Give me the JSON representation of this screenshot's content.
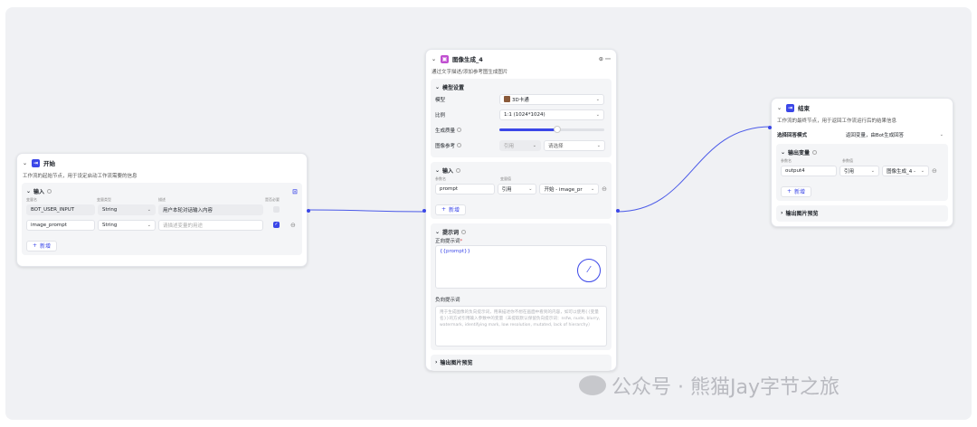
{
  "colors": {
    "accent": "#3b47e8",
    "start_icon": "#3b47e8",
    "image_icon": "#c04fd0",
    "end_icon": "#3b47e8"
  },
  "start_node": {
    "title": "开始",
    "icon": "start-icon",
    "description": "工作流的起始节点，用于设定启动工作流需要的信息",
    "input_section": "输入",
    "col_var": "变量名",
    "col_type": "变量类型",
    "col_desc": "描述",
    "col_required": "是否必要",
    "rows": [
      {
        "name": "BOT_USER_INPUT",
        "type": "String",
        "desc": "用户本轮对话输入内容"
      },
      {
        "name": "image_prompt",
        "type": "String",
        "desc": "请描述变量的用途"
      }
    ],
    "add_label": "新增"
  },
  "image_node": {
    "title": "图像生成_4",
    "icon": "image-icon",
    "description": "通过文字描述/添加参考图生成图片",
    "model_section": "模型设置",
    "model_label": "模型",
    "model_value": "3D卡通",
    "ratio_label": "比例",
    "ratio_value": "1:1 (1024*1024)",
    "quality_label": "生成质量",
    "quality_value": 0.55,
    "ref_label": "图像参考",
    "ref_value": "引用",
    "ref_select": "请选择",
    "input_section": "输入",
    "col_param": "参数名",
    "col_value": "变量值",
    "input_row": {
      "name": "prompt",
      "type": "引用",
      "value": "开始 - image_pr"
    },
    "add_label": "新增",
    "prompt_section": "提示词",
    "positive_label": "正向提示词",
    "positive_value": "{{prompt}}",
    "negative_label": "负向提示词",
    "negative_placeholder": "用于生成图像的负向提示词，用来描述你不想在画面中看到的内容，如可以使用{{变量名}}的方式引用输入参数中的变量（未提取默认保留负向提示词：nsfw, nude, blurry, watermark, identifying mark, low resolution, mutated, lack of hierarchy）",
    "output_preview": "输出图片预览"
  },
  "end_node": {
    "title": "结束",
    "icon": "end-icon",
    "description": "工作流的最终节点，用于返回工作流运行后的结果信息",
    "mode_label": "选择回答模式",
    "mode_value": "返回变量，由Bot生成回答",
    "output_section": "输出变量",
    "col_param": "参数名",
    "col_value": "参数值",
    "output_row": {
      "name": "output4",
      "type": "引用",
      "value": "图像生成_4 -"
    },
    "add_label": "新增",
    "output_preview": "输出图片预览"
  },
  "watermark": "公众号 · 熊猫Jay字节之旅"
}
